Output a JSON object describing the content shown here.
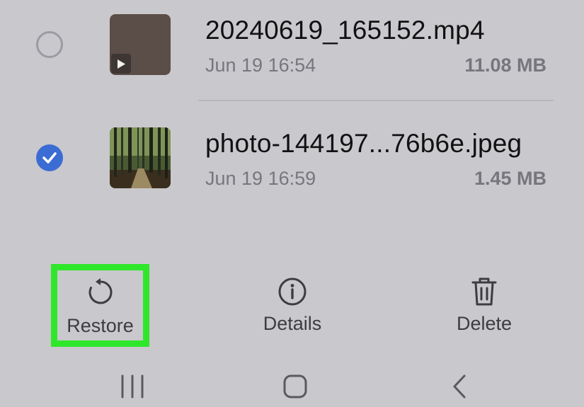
{
  "files": [
    {
      "name": "20240619_165152.mp4",
      "date": "Jun 19 16:54",
      "size": "11.08 MB",
      "selected": false,
      "type": "video"
    },
    {
      "name": "photo-144197...76b6e.jpeg",
      "date": "Jun 19 16:59",
      "size": "1.45 MB",
      "selected": true,
      "type": "image"
    }
  ],
  "actions": {
    "restore_label": "Restore",
    "details_label": "Details",
    "delete_label": "Delete"
  },
  "colors": {
    "background": "#c9c8cd",
    "checkbox_selected": "#3b6cd4",
    "highlight": "#2fe72a"
  },
  "icons": {
    "restore": "restore-icon",
    "details": "info-icon",
    "delete": "trash-icon",
    "recents": "recents-icon",
    "home": "home-icon",
    "back": "back-icon",
    "play": "play-icon"
  }
}
